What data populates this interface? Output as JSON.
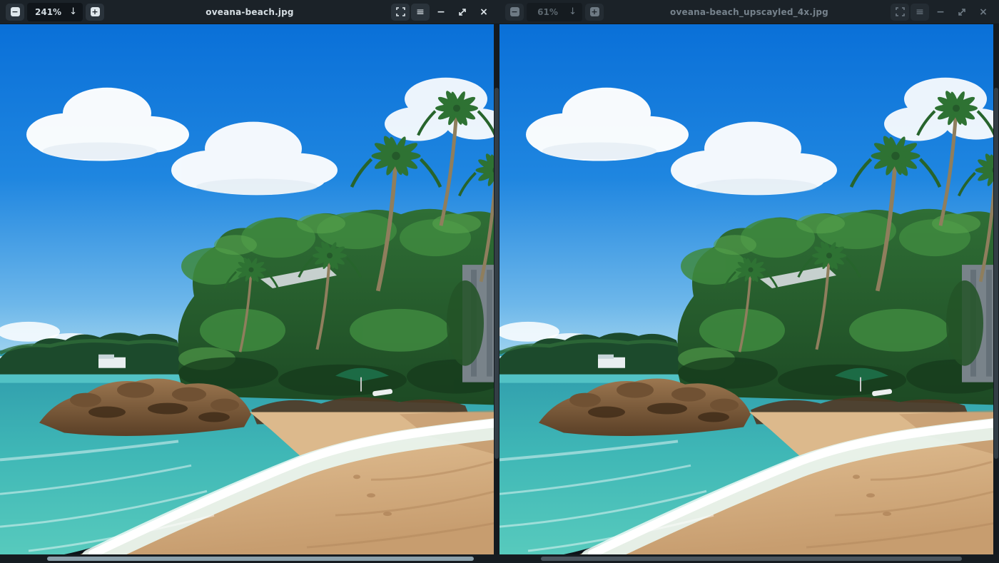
{
  "windows": [
    {
      "title": "oveana-beach.jpg",
      "zoom_level": "241%",
      "state": "active",
      "toolbar": {
        "zoom_out_icon": "−",
        "zoom_in_icon": "+",
        "zoom_dropdown_icon": "↓",
        "menu_icon": "≡",
        "minimize_icon": "−",
        "close_icon": "×"
      }
    },
    {
      "title": "oveana-beach_upscayled_4x.jpg",
      "zoom_level": "61%",
      "state": "inactive",
      "toolbar": {
        "zoom_out_icon": "−",
        "zoom_in_icon": "+",
        "zoom_dropdown_icon": "↓",
        "menu_icon": "≡",
        "minimize_icon": "−",
        "close_icon": "×"
      }
    }
  ],
  "image": {
    "subject": "Tropical beach with palm trees, turquoise sea, breaking surf, golden sand, a rocky outcrop and a blue sky with white clouds"
  },
  "colors": {
    "toolbar_background": "#1b2228",
    "toolbar_button": "#2a333b",
    "toolbar_text_active": "#d6dee3",
    "toolbar_text_inactive": "#6b7680",
    "scrollbar_thumb_active": "#8ba0ab",
    "scrollbar_thumb_inactive": "#4b565f",
    "sky_blue": "#1a7fd9",
    "sea_turquoise": "#45bdb8",
    "sand": "#d8b285"
  }
}
